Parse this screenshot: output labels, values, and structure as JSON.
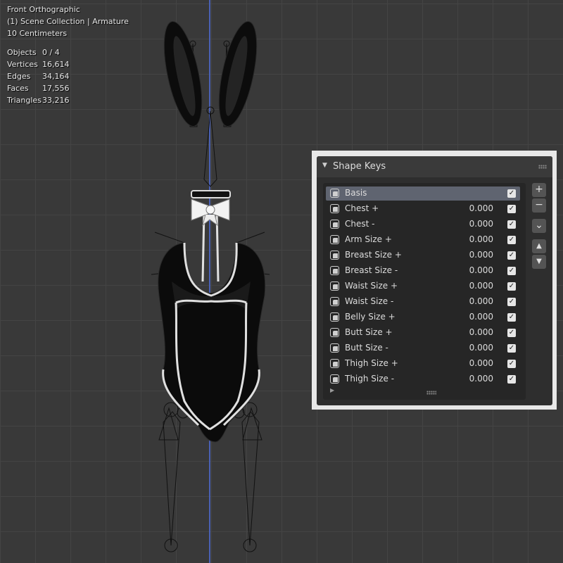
{
  "viewport": {
    "view_name": "Front Orthographic",
    "collection": "(1) Scene Collection | Armature",
    "scale": "10 Centimeters"
  },
  "stats": [
    {
      "label": "Objects",
      "value": "0 / 4"
    },
    {
      "label": "Vertices",
      "value": "16,614"
    },
    {
      "label": "Edges",
      "value": "34,164"
    },
    {
      "label": "Faces",
      "value": "17,556"
    },
    {
      "label": "Triangles",
      "value": "33,216"
    }
  ],
  "shape_keys": {
    "title": "Shape Keys",
    "items": [
      {
        "name": "Basis",
        "value": "",
        "enabled": true,
        "active": true
      },
      {
        "name": "Chest +",
        "value": "0.000",
        "enabled": true
      },
      {
        "name": "Chest -",
        "value": "0.000",
        "enabled": true
      },
      {
        "name": "Arm Size +",
        "value": "0.000",
        "enabled": true
      },
      {
        "name": "Breast Size +",
        "value": "0.000",
        "enabled": true
      },
      {
        "name": "Breast Size -",
        "value": "0.000",
        "enabled": true
      },
      {
        "name": "Waist Size +",
        "value": "0.000",
        "enabled": true
      },
      {
        "name": "Waist Size -",
        "value": "0.000",
        "enabled": true
      },
      {
        "name": "Belly Size +",
        "value": "0.000",
        "enabled": true
      },
      {
        "name": "Butt Size +",
        "value": "0.000",
        "enabled": true
      },
      {
        "name": "Butt Size -",
        "value": "0.000",
        "enabled": true
      },
      {
        "name": "Thigh Size +",
        "value": "0.000",
        "enabled": true
      },
      {
        "name": "Thigh Size -",
        "value": "0.000",
        "enabled": true
      }
    ],
    "buttons": {
      "add": "+",
      "remove": "−",
      "specials": "⌄",
      "move_up": "▲",
      "move_down": "▼"
    },
    "check_glyph": "✓"
  },
  "colors": {
    "accent": "#5f6470",
    "z_axis": "#4a61b5"
  }
}
